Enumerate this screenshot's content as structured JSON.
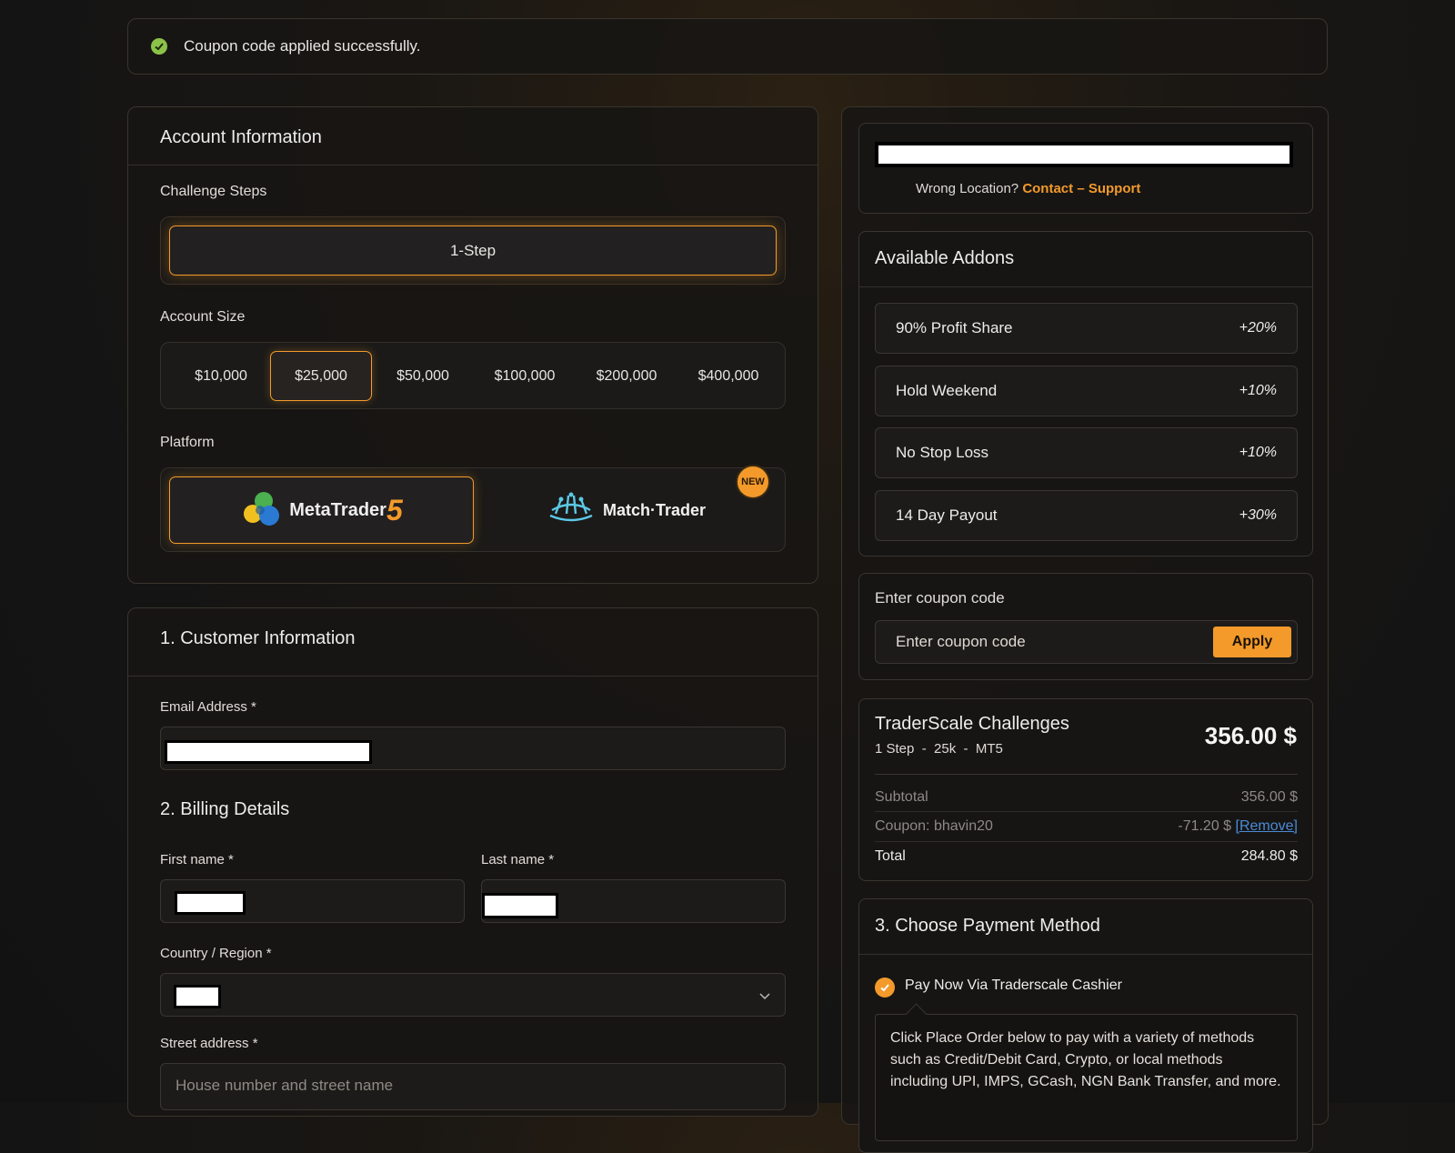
{
  "notice": {
    "text": "Coupon code applied successfully."
  },
  "account": {
    "title": "Account Information",
    "steps_label": "Challenge Steps",
    "step_option": "1-Step",
    "size_label": "Account Size",
    "sizes": [
      "$10,000",
      "$25,000",
      "$50,000",
      "$100,000",
      "$200,000",
      "$400,000"
    ],
    "selected_size": "$25,000",
    "platform_label": "Platform",
    "platforms": {
      "mt5_text": "MetaTrader",
      "mt5_num": "5",
      "match_text": "Match·Trader",
      "new_badge": "NEW"
    }
  },
  "customer": {
    "title": "1. Customer Information",
    "email_label": "Email Address *",
    "billing_title": "2. Billing Details",
    "first_name_label": "First name *",
    "last_name_label": "Last name *",
    "country_label": "Country / Region *",
    "street_label": "Street address *",
    "street_placeholder": "House number and street name"
  },
  "location": {
    "prefix": "Wrong Location?",
    "link": "Contact – Support"
  },
  "addons": {
    "title": "Available Addons",
    "items": [
      {
        "name": "90% Profit Share",
        "pct": "+20%"
      },
      {
        "name": "Hold Weekend",
        "pct": "+10%"
      },
      {
        "name": "No Stop Loss",
        "pct": "+10%"
      },
      {
        "name": "14 Day Payout",
        "pct": "+30%"
      }
    ]
  },
  "coupon": {
    "label": "Enter coupon code",
    "placeholder": "Enter coupon code",
    "apply": "Apply"
  },
  "summary": {
    "product": "TraderScale Challenges",
    "details": "1 Step  -  25k  -  MT5",
    "price": "356.00 $",
    "subtotal_label": "Subtotal",
    "subtotal": "356.00 $",
    "coupon_label": "Coupon: bhavin20",
    "coupon_value": "-71.20 $",
    "remove": "[Remove]",
    "total_label": "Total",
    "total": "284.80 $"
  },
  "payment": {
    "title": "3. Choose Payment Method",
    "option": "Pay Now Via Traderscale Cashier",
    "description": "Click Place Order below to pay with a variety of methods such as Credit/Debit Card, Crypto, or local methods including UPI, IMPS, GCash, NGN Bank Transfer, and more."
  },
  "colors": {
    "accent": "#f39a2a",
    "success": "#8bc34a",
    "link": "#4a8bd6"
  }
}
